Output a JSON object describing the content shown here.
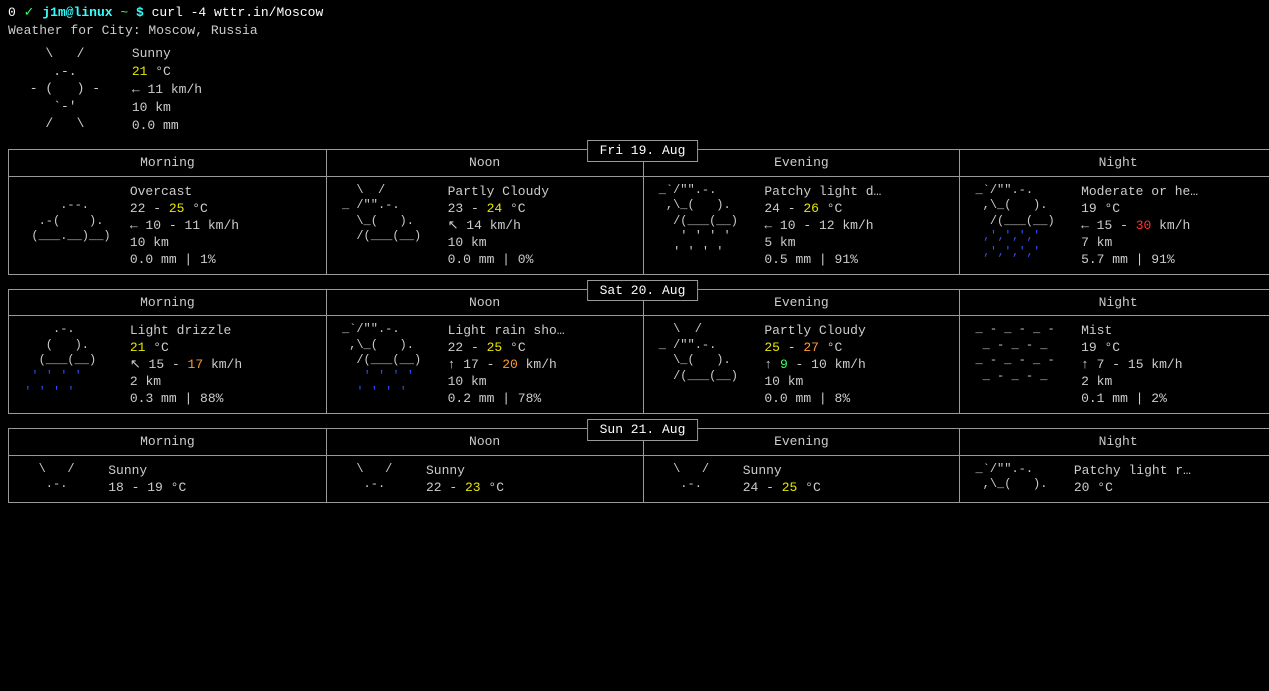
{
  "prompt": {
    "index": "0",
    "check": "✓",
    "userhost": "j1m@linux",
    "tilde": "~",
    "dollar": "$",
    "cmd": "curl -4 wttr.in/Moscow"
  },
  "header": "Weather for City: Moscow, Russia",
  "current": {
    "art": "   \\   /   \n    .-.    \n - (   ) - \n    `-'    \n   /   \\   ",
    "desc": "Sunny",
    "temp_val": "21",
    "temp_unit": " °C",
    "wind_arrow": "←",
    "wind_val": " 11 km/h",
    "visibility": "10 km",
    "precip": "0.0 mm"
  },
  "labels": {
    "morning": "Morning",
    "noon": "Noon",
    "evening": "Evening",
    "night": "Night"
  },
  "days": [
    {
      "title": "Fri 19. Aug",
      "periods": [
        {
          "art": "              \n      .--.    \n   .-(    ).  \n  (___.__)__) \n              ",
          "desc": "Overcast",
          "temp_prefix": "22 - ",
          "temp_main": "25",
          "temp_class": "hot1",
          "temp_unit": " °C",
          "wind_arrow": "←",
          "wind_prefix": " 10 - ",
          "wind_main": "11",
          "wind_class": "",
          "wind_unit": " km/h",
          "vis": "10 km",
          "precip": "0.0 mm | 1%"
        },
        {
          "art": "   \\  /       \n _ /\"\".-.    \n   \\_(   ).  \n   /(___(__)  \n              ",
          "desc": "Partly Cloudy",
          "temp_prefix": "23 - ",
          "temp_main": "24",
          "temp_class": "hot1",
          "temp_unit": " °C",
          "wind_arrow": "↖",
          "wind_prefix": " ",
          "wind_main": "14",
          "wind_class": "",
          "wind_unit": " km/h",
          "vis": "10 km",
          "precip": "0.0 mm | 0%"
        },
        {
          "art": " _`/\"\".-.    \n  ,\\_(   ).  \n   /(___(__)  \n    ' ' ' '   \n   ' ' ' '    ",
          "desc": "Patchy light d…",
          "temp_prefix": "24 - ",
          "temp_main": "26",
          "temp_class": "hot1",
          "temp_unit": " °C",
          "wind_arrow": "←",
          "wind_prefix": " 10 - ",
          "wind_main": "12",
          "wind_class": "",
          "wind_unit": " km/h",
          "vis": "5 km",
          "precip": "0.5 mm | 91%"
        },
        {
          "art_html": " _`/\"\".-.    \n  ,\\_(   ).  \n   /(___(__)  \n  <span class=\"blue\">‚'‚'‚'‚'</span>    \n  <span class=\"blue\">‚'‚'‚'‚'</span>    ",
          "desc": "Moderate or he…",
          "temp_prefix": "",
          "temp_main": "19",
          "temp_class": "",
          "temp_unit": " °C",
          "wind_arrow": "←",
          "wind_prefix": " 15 - ",
          "wind_main": "30",
          "wind_class": "hot3",
          "wind_unit": " km/h",
          "vis": "7 km",
          "precip": "5.7 mm | 91%"
        }
      ]
    },
    {
      "title": "Sat 20. Aug",
      "periods": [
        {
          "art_html": "     .-.      \n    (   ).    \n   (___(__)   \n  <span class=\"blue\">' ' ' '</span>     \n <span class=\"blue\">' ' ' '</span>      ",
          "desc": "Light drizzle",
          "temp_prefix": "",
          "temp_main": "21",
          "temp_class": "hot1",
          "temp_unit": " °C",
          "wind_arrow": "↖",
          "wind_prefix": " 15 - ",
          "wind_main": "17",
          "wind_class": "hot2",
          "wind_unit": " km/h",
          "vis": "2 km",
          "precip": "0.3 mm | 88%"
        },
        {
          "art_html": " _`/\"\".-.    \n  ,\\_(   ).  \n   /(___(__)  \n    <span class=\"blue\">' ' ' '</span>   \n   <span class=\"blue\">' ' ' '</span>    ",
          "desc": "Light rain sho…",
          "temp_prefix": "22 - ",
          "temp_main": "25",
          "temp_class": "hot1",
          "temp_unit": " °C",
          "wind_arrow": "↑",
          "wind_prefix": " 17 - ",
          "wind_main": "20",
          "wind_class": "hot2",
          "wind_unit": " km/h",
          "vis": "10 km",
          "precip": "0.2 mm | 78%"
        },
        {
          "art": "   \\  /       \n _ /\"\".-.    \n   \\_(   ).  \n   /(___(__)  \n              ",
          "desc": "Partly Cloudy",
          "temp_prefix": "25 - ",
          "pre_class": "hot1",
          "temp_main": "27",
          "temp_class": "hot2",
          "temp_unit": " °C",
          "wind_arrow": "↑",
          "wind_prefix": " ",
          "wind_pre_val": "9",
          "wind_pre_class": "green",
          "wind_sep": " - ",
          "wind_main": "10",
          "wind_class": "",
          "wind_unit": " km/h",
          "vis": "10 km",
          "precip": "0.0 mm | 8%"
        },
        {
          "art": " _ - _ - _ -  \n  _ - _ - _   \n _ - _ - _ -  \n  _ - _ - _   \n              ",
          "desc": "Mist",
          "temp_prefix": "",
          "temp_main": "19",
          "temp_class": "",
          "temp_unit": " °C",
          "wind_arrow": "↑",
          "wind_prefix": " 7 - ",
          "wind_main": "15",
          "wind_class": "",
          "wind_unit": " km/h",
          "vis": "2 km",
          "precip": "0.1 mm | 2%"
        }
      ]
    },
    {
      "title": "Sun 21. Aug",
      "short": true,
      "periods": [
        {
          "art": "   \\   /   \n    .-.    ",
          "desc": "Sunny",
          "temp_prefix": "18 - ",
          "temp_main": "19",
          "temp_class": "",
          "temp_unit": " °C"
        },
        {
          "art": "   \\   /   \n    .-.    ",
          "desc": "Sunny",
          "temp_prefix": "22 - ",
          "temp_main": "23",
          "temp_class": "hot1",
          "temp_unit": " °C"
        },
        {
          "art": "   \\   /   \n    .-.    ",
          "desc": "Sunny",
          "temp_prefix": "24 - ",
          "temp_main": "25",
          "temp_class": "hot1",
          "temp_unit": " °C"
        },
        {
          "art": " _`/\"\".-.    \n  ,\\_(   ).  ",
          "desc": "Patchy light r…",
          "temp_prefix": "",
          "temp_main": "20",
          "temp_class": "",
          "temp_unit": " °C"
        }
      ]
    }
  ]
}
